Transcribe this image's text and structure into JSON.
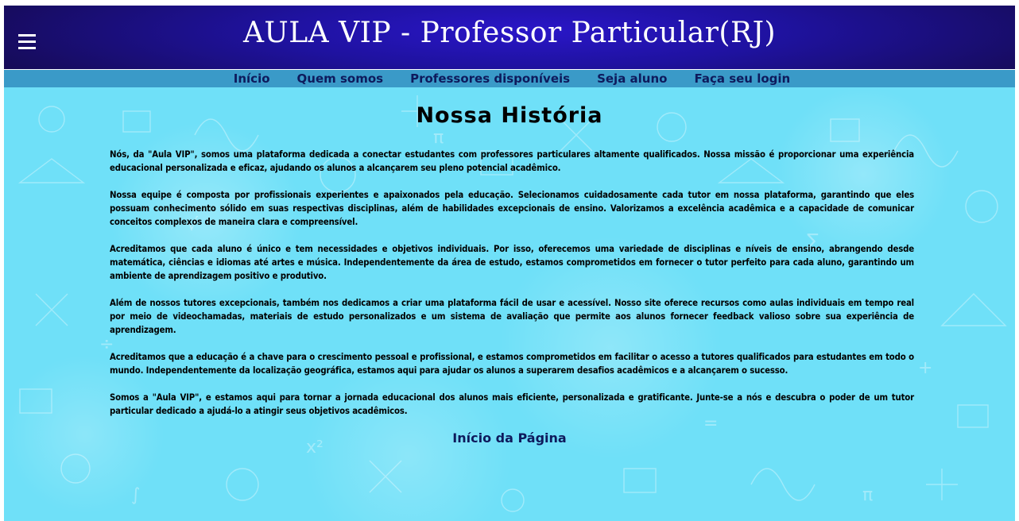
{
  "header": {
    "title": "AULA VIP - Professor Particular(RJ)",
    "menu_icon": "hamburger-menu-icon"
  },
  "nav": {
    "items": [
      {
        "label": "Início"
      },
      {
        "label": "Quem somos"
      },
      {
        "label": "Professores disponíveis"
      },
      {
        "label": "Seja aluno"
      },
      {
        "label": "Faça seu login"
      }
    ]
  },
  "main": {
    "title": "Nossa História",
    "paragraphs": [
      "Nós, da \"Aula VIP\", somos uma plataforma dedicada a conectar estudantes com professores particulares altamente qualificados. Nossa missão é proporcionar uma experiência educacional personalizada e eficaz, ajudando os alunos a alcançarem seu pleno potencial acadêmico.",
      "Nossa equipe é composta por profissionais experientes e apaixonados pela educação. Selecionamos cuidadosamente cada tutor em nossa plataforma, garantindo que eles possuam conhecimento sólido em suas respectivas disciplinas, além de habilidades excepcionais de ensino. Valorizamos a excelência acadêmica e a capacidade de comunicar conceitos complexos de maneira clara e compreensível.",
      "Acreditamos que cada aluno é único e tem necessidades e objetivos individuais. Por isso, oferecemos uma variedade de disciplinas e níveis de ensino, abrangendo desde matemática, ciências e idiomas até artes e música. Independentemente da área de estudo, estamos comprometidos em fornecer o tutor perfeito para cada aluno, garantindo um ambiente de aprendizagem positivo e produtivo.",
      "Além de nossos tutores excepcionais, também nos dedicamos a criar uma plataforma fácil de usar e acessível. Nosso site oferece recursos como aulas individuais em tempo real por meio de videochamadas, materiais de estudo personalizados e um sistema de avaliação que permite aos alunos fornecer feedback valioso sobre sua experiência de aprendizagem.",
      "Acreditamos que a educação é a chave para o crescimento pessoal e profissional, e estamos comprometidos em facilitar o acesso a tutores qualificados para estudantes em todo o mundo. Independentemente da localização geográfica, estamos aqui para ajudar os alunos a superarem desafios acadêmicos e a alcançarem o sucesso.",
      "Somos a \"Aula VIP\", e estamos aqui para tornar a jornada educacional dos alunos mais eficiente, personalizada e gratificante. Junte-se a nós e descubra o poder de um tutor particular dedicado a ajudá-lo a atingir seus objetivos acadêmicos."
    ],
    "top_link": "Início da Página"
  },
  "colors": {
    "header_bg": "#1f12a0",
    "nav_bg": "#3a9ac8",
    "nav_text": "#0e1a5c",
    "content_bg": "#6fe0f8"
  }
}
